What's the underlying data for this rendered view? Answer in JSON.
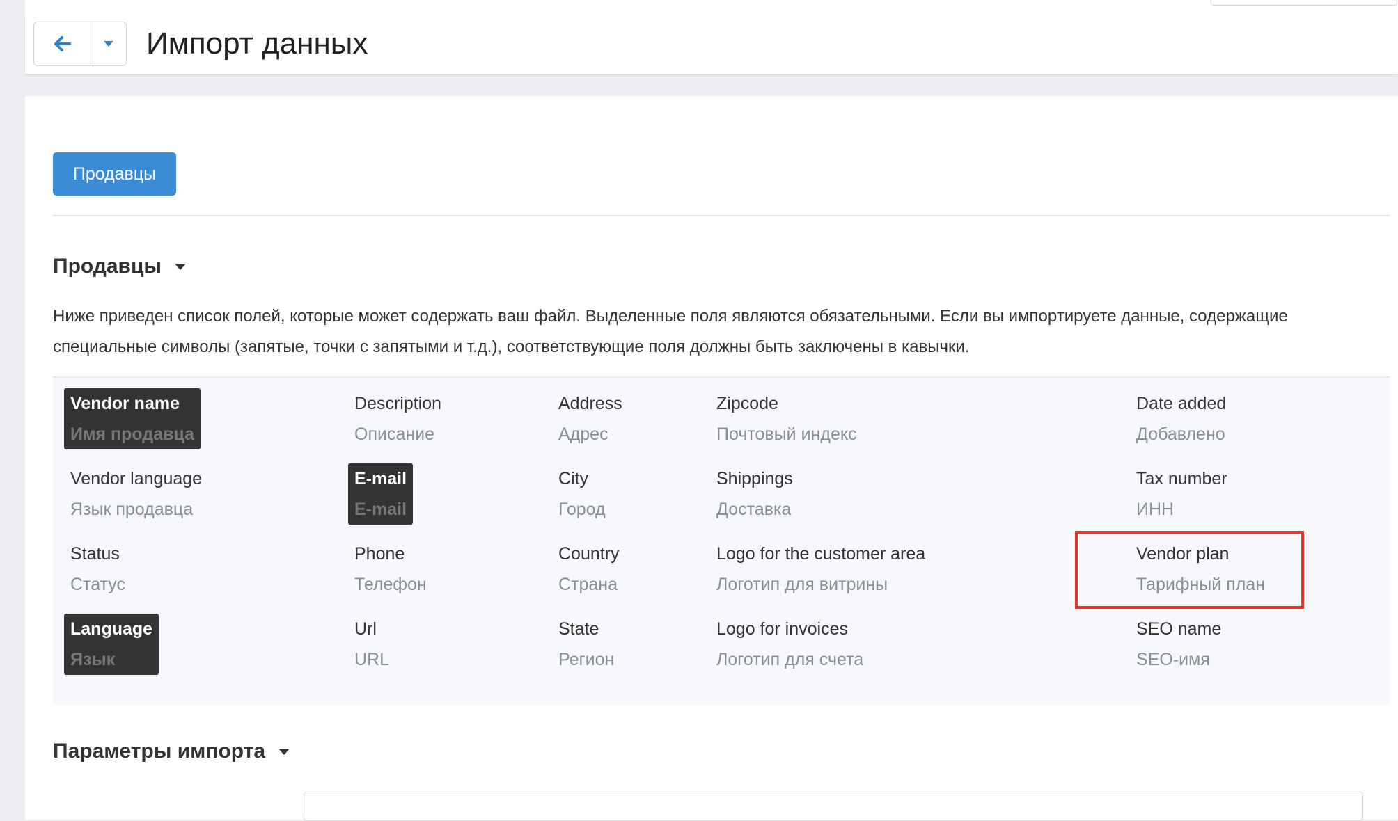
{
  "header": {
    "title": "Импорт данных",
    "back_icon": "arrow-left-icon",
    "menu_icon": "caret-down-icon"
  },
  "tabs": [
    {
      "label": "Продавцы",
      "active": true
    }
  ],
  "section_vendors": {
    "title": "Продавцы",
    "description": "Ниже приведен список полей, которые может содержать ваш файл. Выделенные поля являются обязательными. Если вы импортируете данные, содержащие специальные символы (запятые, точки с запятыми и т.д.), соответствующие поля должны быть заключены в кавычки."
  },
  "fields": [
    {
      "name": "Vendor name",
      "label": "Имя продавца",
      "required": true
    },
    {
      "name": "Vendor language",
      "label": "Язык продавца",
      "required": false
    },
    {
      "name": "Status",
      "label": "Статус",
      "required": false
    },
    {
      "name": "Language",
      "label": "Язык",
      "required": true
    },
    {
      "name": "Description",
      "label": "Описание",
      "required": false
    },
    {
      "name": "E-mail",
      "label": "E-mail",
      "required": true
    },
    {
      "name": "Phone",
      "label": "Телефон",
      "required": false
    },
    {
      "name": "Url",
      "label": "URL",
      "required": false
    },
    {
      "name": "Address",
      "label": "Адрес",
      "required": false
    },
    {
      "name": "City",
      "label": "Город",
      "required": false
    },
    {
      "name": "Country",
      "label": "Страна",
      "required": false
    },
    {
      "name": "State",
      "label": "Регион",
      "required": false
    },
    {
      "name": "Zipcode",
      "label": "Почтовый индекс",
      "required": false
    },
    {
      "name": "Shippings",
      "label": "Доставка",
      "required": false
    },
    {
      "name": "Logo for the customer area",
      "label": "Логотип для витрины",
      "required": false
    },
    {
      "name": "Logo for invoices",
      "label": "Логотип для счета",
      "required": false
    },
    {
      "name": "Date added",
      "label": "Добавлено",
      "required": false
    },
    {
      "name": "Tax number",
      "label": "ИНН",
      "required": false
    },
    {
      "name": "Vendor plan",
      "label": "Тарифный план",
      "required": false,
      "highlighted": true
    },
    {
      "name": "SEO name",
      "label": "SEO-имя",
      "required": false
    }
  ],
  "section_import_params": {
    "title": "Параметры импорта"
  },
  "colors": {
    "primary_button": "#3a8bd6",
    "required_badge": "#333333",
    "highlight_outline": "#e03a2e"
  }
}
